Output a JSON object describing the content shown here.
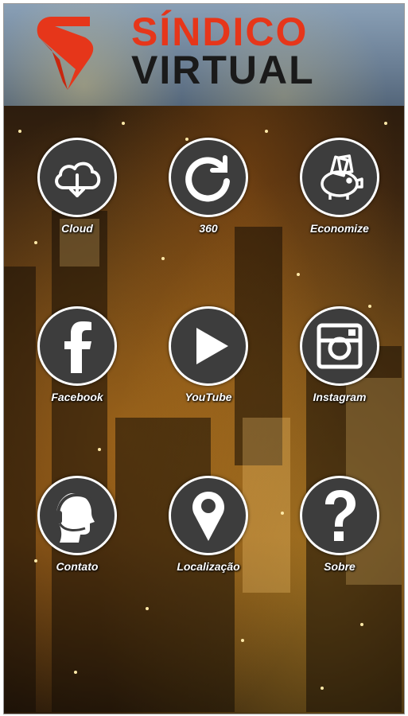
{
  "brand": {
    "line1": "SÍNDICO",
    "line2": "VIRTUAL",
    "accent_color": "#e6361a"
  },
  "grid": {
    "items": [
      {
        "label": "Cloud",
        "icon": "cloud-download-icon"
      },
      {
        "label": "360",
        "icon": "refresh-icon"
      },
      {
        "label": "Economize",
        "icon": "piggy-bank-icon"
      },
      {
        "label": "Facebook",
        "icon": "facebook-icon"
      },
      {
        "label": "YouTube",
        "icon": "play-icon"
      },
      {
        "label": "Instagram",
        "icon": "instagram-icon"
      },
      {
        "label": "Contato",
        "icon": "headset-icon"
      },
      {
        "label": "Localização",
        "icon": "location-pin-icon"
      },
      {
        "label": "Sobre",
        "icon": "question-icon"
      }
    ]
  }
}
